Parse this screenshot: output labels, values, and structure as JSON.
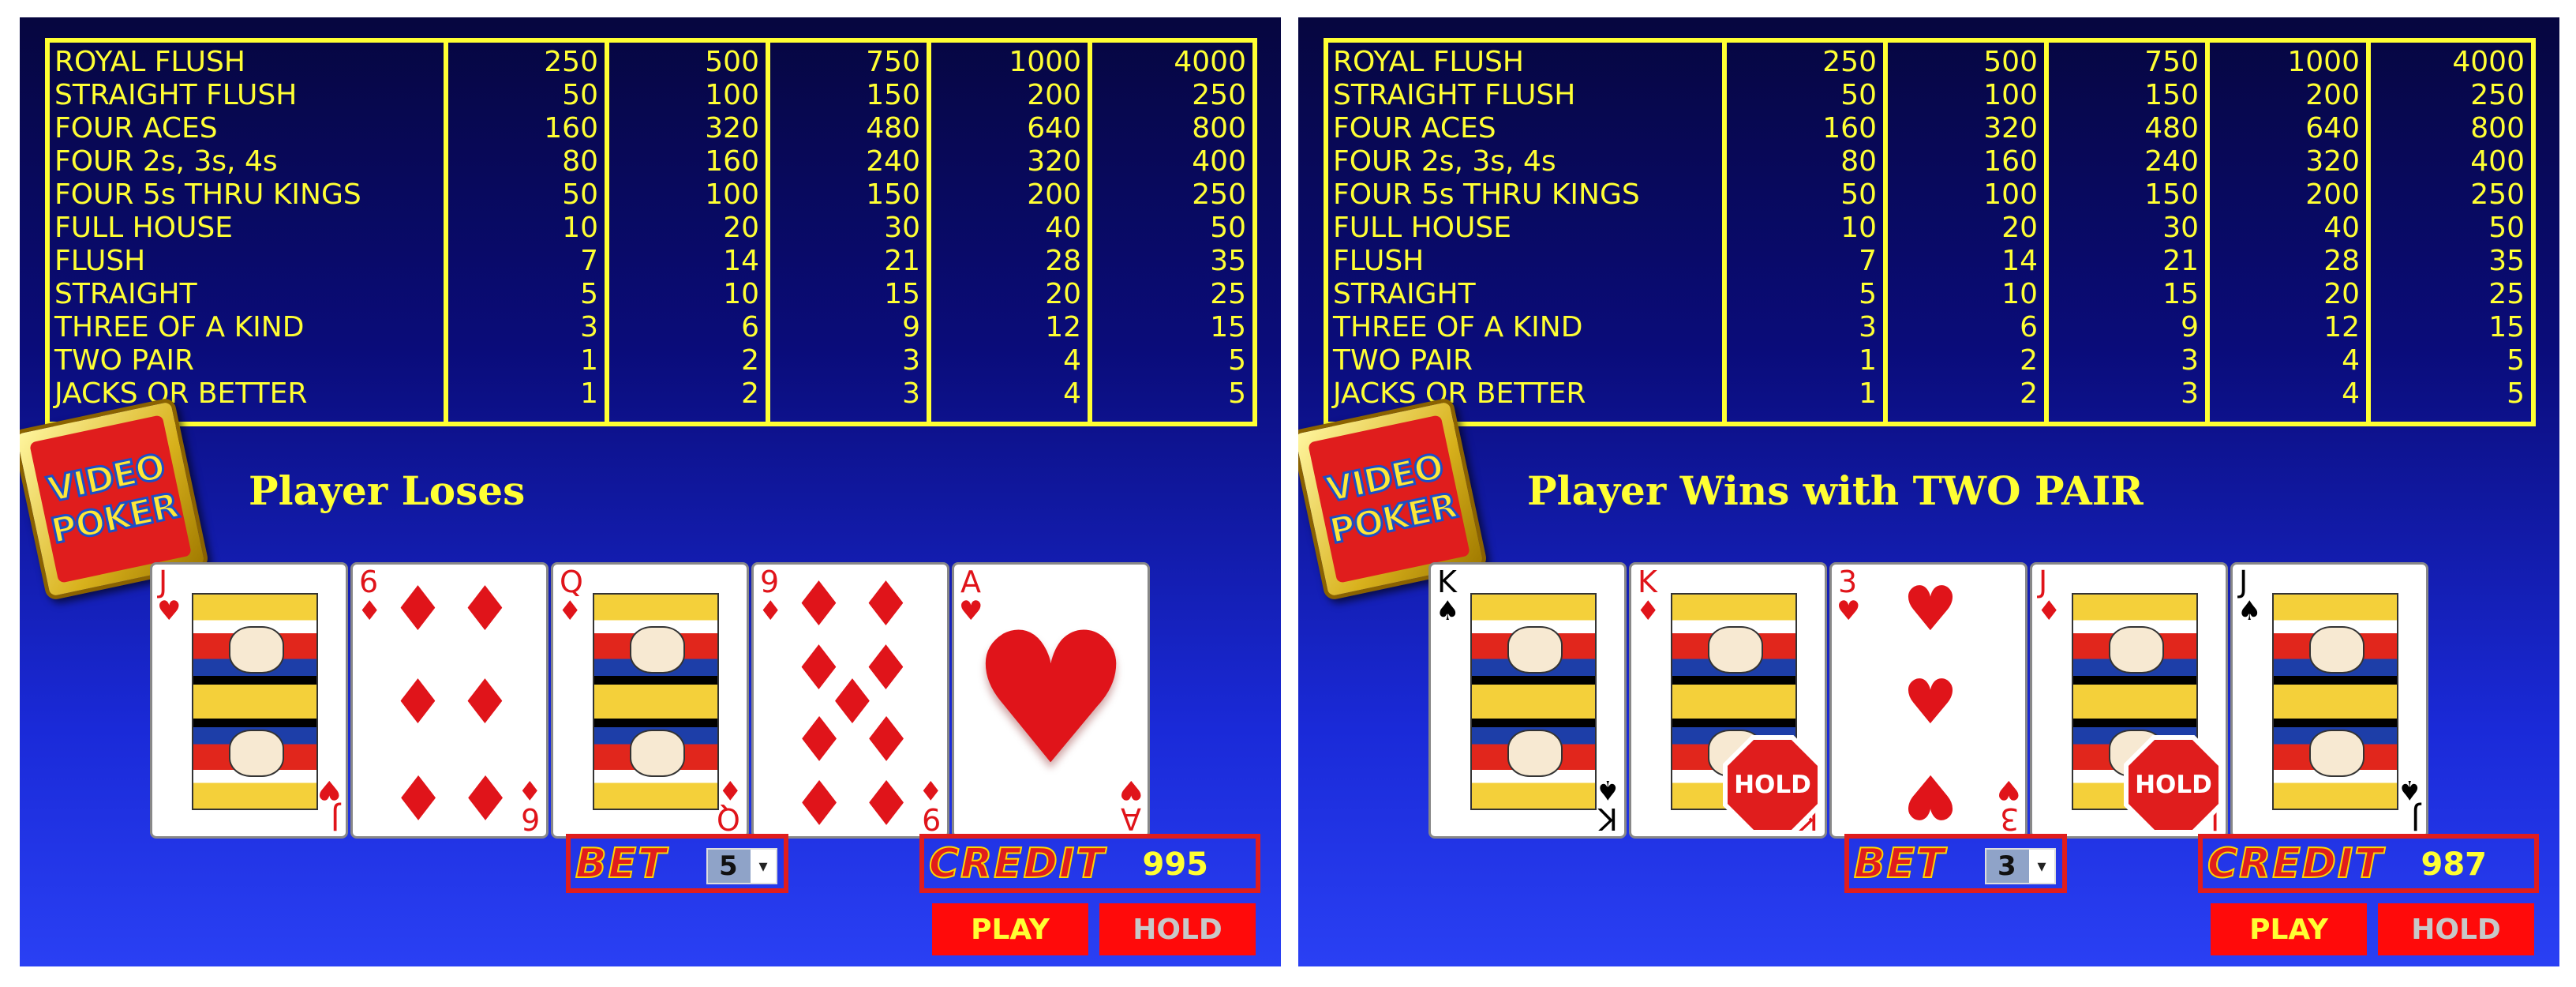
{
  "paytable": {
    "hands": [
      "ROYAL FLUSH",
      "STRAIGHT FLUSH",
      "FOUR ACES",
      "FOUR 2s, 3s, 4s",
      "FOUR 5s THRU KINGS",
      "FULL HOUSE",
      "FLUSH",
      "STRAIGHT",
      "THREE OF A KIND",
      "TWO PAIR",
      "JACKS OR BETTER"
    ],
    "columns": [
      [
        "250",
        "50",
        "160",
        "80",
        "50",
        "10",
        "7",
        "5",
        "3",
        "1",
        "1"
      ],
      [
        "500",
        "100",
        "320",
        "160",
        "100",
        "20",
        "14",
        "10",
        "6",
        "2",
        "2"
      ],
      [
        "750",
        "150",
        "480",
        "240",
        "150",
        "30",
        "21",
        "15",
        "9",
        "3",
        "3"
      ],
      [
        "1000",
        "200",
        "640",
        "320",
        "200",
        "40",
        "28",
        "20",
        "12",
        "4",
        "4"
      ],
      [
        "4000",
        "250",
        "800",
        "400",
        "250",
        "50",
        "35",
        "25",
        "15",
        "5",
        "5"
      ]
    ]
  },
  "logo": {
    "line1": "VIDEO",
    "line2": "POKER"
  },
  "labels": {
    "bet": "BET",
    "credit": "CREDIT",
    "play": "PLAY",
    "hold": "HOLD",
    "hold_badge": "HOLD"
  },
  "left": {
    "status": "Player Loses",
    "bet": "5",
    "credit": "995",
    "cards": [
      {
        "rank": "J",
        "suit": "♥",
        "color": "red",
        "kind": "face"
      },
      {
        "rank": "6",
        "suit": "♦",
        "color": "red",
        "kind": "pips"
      },
      {
        "rank": "Q",
        "suit": "♦",
        "color": "red",
        "kind": "face"
      },
      {
        "rank": "9",
        "suit": "♦",
        "color": "red",
        "kind": "pips"
      },
      {
        "rank": "A",
        "suit": "♥",
        "color": "red",
        "kind": "ace"
      }
    ]
  },
  "right": {
    "status": "Player Wins with TWO PAIR",
    "bet": "3",
    "credit": "987",
    "cards": [
      {
        "rank": "K",
        "suit": "♠",
        "color": "black",
        "kind": "face",
        "held": false
      },
      {
        "rank": "K",
        "suit": "♦",
        "color": "red",
        "kind": "face",
        "held": true
      },
      {
        "rank": "3",
        "suit": "♥",
        "color": "red",
        "kind": "pips",
        "held": false
      },
      {
        "rank": "J",
        "suit": "♦",
        "color": "red",
        "kind": "face",
        "held": true
      },
      {
        "rank": "J",
        "suit": "♠",
        "color": "black",
        "kind": "face",
        "held": false
      }
    ]
  },
  "colors": {
    "paytable_text": "#ffff33",
    "button_red": "#ff0a0a",
    "status_text": "#ffff33"
  }
}
